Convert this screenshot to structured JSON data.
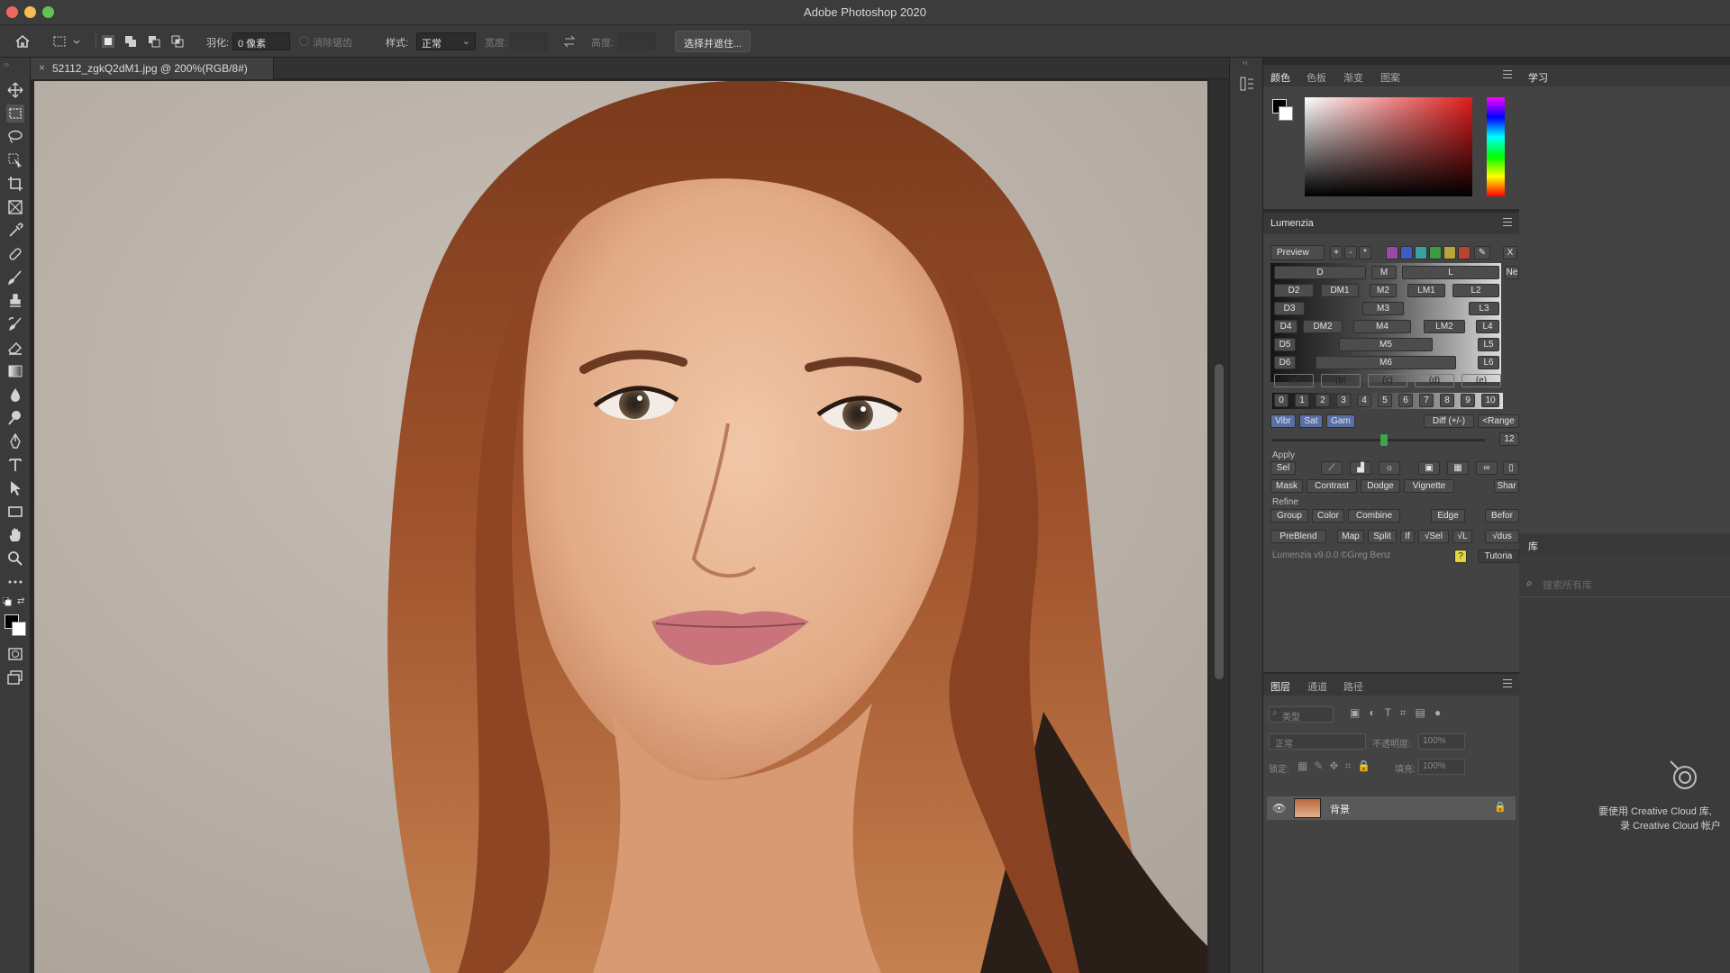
{
  "app": {
    "title": "Adobe Photoshop 2020"
  },
  "options_bar": {
    "feather_label": "羽化:",
    "feather_value": "0 像素",
    "antialias_label": "消除锯齿",
    "style_label": "样式:",
    "style_value": "正常",
    "width_label": "宽度:",
    "height_label": "高度:",
    "select_mask_button": "选择并遮住..."
  },
  "document": {
    "tab_title": "52112_zgkQ2dM1.jpg @ 200%(RGB/8#)"
  },
  "color_panel": {
    "tabs": [
      "颜色",
      "色板",
      "渐变",
      "图案"
    ],
    "active_tab": "颜色"
  },
  "learn_panel": {
    "tab": "学习"
  },
  "lumenzia": {
    "title": "Lumenzia",
    "preview": "Preview",
    "top_symbols": [
      "+",
      "-",
      "*"
    ],
    "swatches": [
      "#9b48a8",
      "#3f5cc4",
      "#3aa0a0",
      "#3d9a45",
      "#b9a63a",
      "#b8432e"
    ],
    "row1": [
      "D",
      "M",
      "L"
    ],
    "row2": [
      "D2",
      "DM1",
      "M2",
      "LM1",
      "L2"
    ],
    "row3": [
      "D3",
      "M3",
      "L3"
    ],
    "row4": [
      "D4",
      "DM2",
      "M4",
      "LM2",
      "L4"
    ],
    "row5": [
      "D5",
      "M5",
      "L5"
    ],
    "row6": [
      "D6",
      "M6",
      "L6"
    ],
    "row7": [
      "(a)",
      "(b)",
      "(c)",
      "(d)",
      "(e)"
    ],
    "numbers": [
      "0",
      "1",
      "2",
      "3",
      "4",
      "5",
      "6",
      "7",
      "8",
      "9",
      "10"
    ],
    "vibr": "Vibr",
    "sat": "Sat",
    "gam": "Gam",
    "diff": "Diff (+/-)",
    "range": "<Range",
    "ne": "Ne",
    "slider_value": "12",
    "apply_label": "Apply",
    "sel": "Sel",
    "apply_buttons": [
      "Mask",
      "Contrast",
      "Dodge",
      "Vignette",
      "Shar"
    ],
    "refine_label": "Refine",
    "refine_buttons": [
      "Group",
      "Color",
      "Combine",
      "Edge",
      "Befor"
    ],
    "util_buttons": [
      "PreBlend",
      "Map",
      "Split",
      "If",
      "√Sel",
      "√L",
      "√dus"
    ],
    "version": "Lumenzia v9.0.0 ©Greg Benz",
    "help": "?",
    "tutorial": "Tutoria"
  },
  "layers_panel": {
    "tabs": [
      "图层",
      "通道",
      "路径"
    ],
    "filter_label": "类型",
    "blend_mode": "正常",
    "opacity_label": "不透明度:",
    "opacity_value": "100%",
    "lock_label": "锁定:",
    "fill_label": "填充:",
    "fill_value": "100%",
    "layer_name": "背景"
  },
  "library_panel": {
    "tab": "库",
    "search_placeholder": "搜索所有库",
    "message_line1": "要使用 Creative Cloud 库,",
    "message_line2": "录 Creative Cloud 帐户"
  },
  "colors": {
    "accent_green": "#3fa54a",
    "hue_red": "#d71c1c"
  }
}
